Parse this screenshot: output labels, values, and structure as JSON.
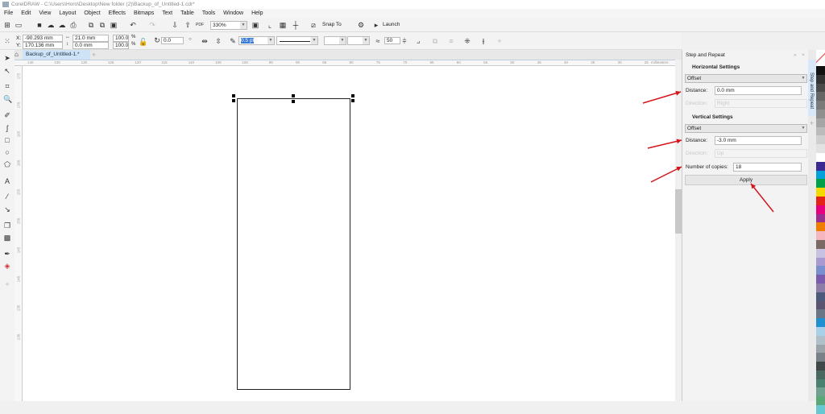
{
  "window": {
    "title": "CorelDRAW - C:\\Users\\Horo\\Desktop\\New folder (2)\\Backup_of_Untitled-1.cdr*"
  },
  "menu": [
    "File",
    "Edit",
    "View",
    "Layout",
    "Object",
    "Effects",
    "Bitmaps",
    "Text",
    "Table",
    "Tools",
    "Window",
    "Help"
  ],
  "toolbar": {
    "zoom": "330%",
    "snap_to": "Snap To",
    "launch": "Launch"
  },
  "property_bar": {
    "x": "-90.293 mm",
    "y": "170.136 mm",
    "width": "21.0 mm",
    "height": "0.0 mm",
    "scale_x": "100.0",
    "scale_y": "100.0",
    "percent": "%",
    "rotation": "0.0",
    "outline_width": "0.5 pt",
    "smoothing": "50"
  },
  "document_tab": "Backup_of_Untitled-1.*",
  "ruler": {
    "h_labels": [
      "140",
      "135",
      "130",
      "125",
      "120",
      "115",
      "110",
      "105",
      "100",
      "95",
      "90",
      "85",
      "80",
      "75",
      "70",
      "65",
      "60",
      "55",
      "50",
      "45",
      "40",
      "35",
      "30",
      "25"
    ],
    "unit": "millimeters",
    "v_labels": [
      "175",
      "170",
      "165",
      "160",
      "155",
      "150",
      "145",
      "140",
      "135",
      "130"
    ]
  },
  "docker": {
    "title": "Step and Repeat",
    "tab_label": "Step and Repeat",
    "horizontal": {
      "heading": "Horizontal Settings",
      "mode": "Offset",
      "distance_label": "Distance:",
      "distance": "0.0 mm",
      "direction_label": "Direction:",
      "direction": "Right"
    },
    "vertical": {
      "heading": "Vertical Settings",
      "mode": "Offset",
      "distance_label": "Distance:",
      "distance": "-3.0 mm",
      "direction_label": "Direction:",
      "direction": "Up"
    },
    "copies_label": "Number of copies:",
    "copies": "18",
    "apply": "Apply"
  },
  "palette": [
    "#111111",
    "#333333",
    "#4a4a4a",
    "#666666",
    "#7a7a7a",
    "#8f8f8f",
    "#a5a5a5",
    "#bbbbbb",
    "#cfcfcf",
    "#e2e2e2",
    "#ffffff",
    "#3b2a91",
    "#00a0d8",
    "#00a04a",
    "#f5d800",
    "#e2231a",
    "#e4007f",
    "#9b2f8f",
    "#f07d00",
    "#f4b6c0",
    "#7a6a63",
    "#c8c2e2",
    "#a89ad0",
    "#7a8fce",
    "#7b5bab",
    "#8b7ca8",
    "#4e5a7c",
    "#5a5470",
    "#6a7585",
    "#2090d0",
    "#a8d0e8",
    "#b0c0c8",
    "#9aa4a8",
    "#7a8088",
    "#404848",
    "#4a6860",
    "#4a8070",
    "#70a090",
    "#5aa878",
    "#68c8d0"
  ],
  "annotation_color": "#d4141c"
}
